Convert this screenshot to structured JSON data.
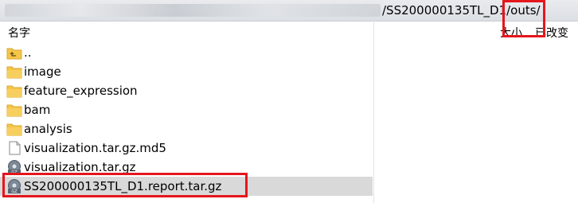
{
  "path": {
    "visible_suffix": "/SS200000135TL_D1/outs/"
  },
  "columns": {
    "name": "名字",
    "size": "大小",
    "modified": "已改变"
  },
  "files": [
    {
      "name": "..",
      "icon": "parent-folder-icon"
    },
    {
      "name": "image",
      "icon": "folder-icon"
    },
    {
      "name": "feature_expression",
      "icon": "folder-icon"
    },
    {
      "name": "bam",
      "icon": "folder-icon"
    },
    {
      "name": "analysis",
      "icon": "folder-icon"
    },
    {
      "name": "visualization.tar.gz.md5",
      "icon": "file-icon"
    },
    {
      "name": "visualization.tar.gz",
      "icon": "archive-icon"
    },
    {
      "name": "SS200000135TL_D1.report.tar.gz",
      "icon": "archive-icon",
      "selected": true
    }
  ],
  "colors": {
    "highlight": "#e5161c",
    "selection": "#d9d9d9",
    "folder": "#f5c54a"
  }
}
